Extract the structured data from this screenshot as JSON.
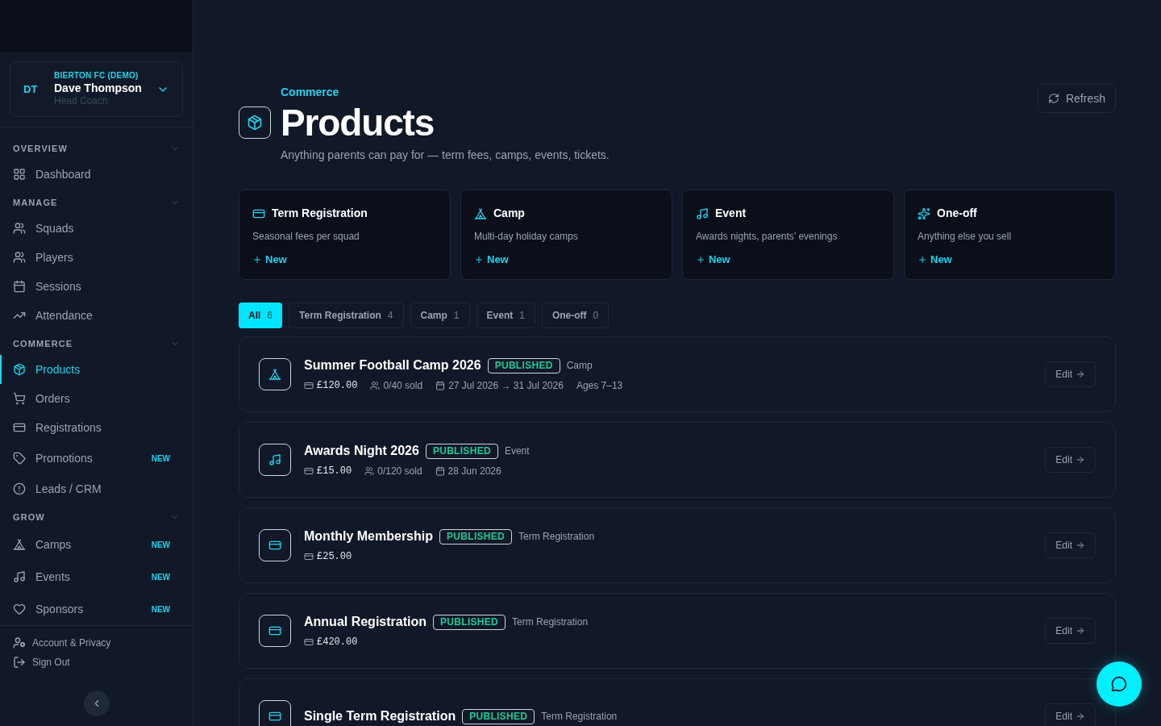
{
  "sidebar": {
    "account": {
      "initials": "DT",
      "org": "BIERTON FC (DEMO)",
      "name": "Dave Thompson",
      "role": "Head Coach"
    },
    "sections": [
      {
        "title": "OVERVIEW",
        "expanded": true,
        "items": [
          {
            "label": "Dashboard",
            "selected": false
          }
        ]
      },
      {
        "title": "MANAGE",
        "expanded": true,
        "items": [
          {
            "label": "Squads",
            "selected": false
          },
          {
            "label": "Players",
            "selected": false
          },
          {
            "label": "Sessions",
            "selected": false
          },
          {
            "label": "Attendance",
            "selected": false
          }
        ]
      },
      {
        "title": "COMMERCE",
        "expanded": true,
        "items": [
          {
            "label": "Products",
            "selected": true
          },
          {
            "label": "Orders",
            "selected": false
          },
          {
            "label": "Registrations",
            "selected": false
          },
          {
            "label": "Promotions",
            "selected": false,
            "badge": "NEW"
          },
          {
            "label": "Leads / CRM",
            "selected": false
          }
        ]
      },
      {
        "title": "GROW",
        "expanded": true,
        "items": [
          {
            "label": "Camps",
            "selected": false,
            "badge": "NEW"
          },
          {
            "label": "Events",
            "selected": false,
            "badge": "NEW"
          },
          {
            "label": "Sponsors",
            "selected": false,
            "badge": "NEW"
          }
        ]
      }
    ],
    "footer_links": [
      "Account & Privacy",
      "Sign Out"
    ]
  },
  "header": {
    "eyebrow": "Commerce",
    "title": "Products",
    "subtitle": "Anything parents can pay for — term fees, camps, events, tickets.",
    "refresh_button": "Refresh"
  },
  "categories": [
    {
      "kind": "term",
      "title": "Term Registration",
      "description": "Seasonal fees per squad",
      "action": "New"
    },
    {
      "kind": "camp",
      "title": "Camp",
      "description": "Multi-day holiday camps",
      "action": "New"
    },
    {
      "kind": "event",
      "title": "Event",
      "description": "Awards nights, parents’ evenings",
      "action": "New"
    },
    {
      "kind": "oneoff",
      "title": "One-off",
      "description": "Anything else you sell",
      "action": "New"
    }
  ],
  "filters": [
    {
      "label": "All",
      "count": "6",
      "selected": true
    },
    {
      "label": "Term Registration",
      "count": "4",
      "selected": false
    },
    {
      "label": "Camp",
      "count": "1",
      "selected": false
    },
    {
      "label": "Event",
      "count": "1",
      "selected": false
    },
    {
      "label": "One-off",
      "count": "0",
      "selected": false
    }
  ],
  "products": [
    {
      "kind": "camp",
      "name": "Summer Football Camp 2026",
      "status": "PUBLISHED",
      "type": "Camp",
      "price": "£120.00",
      "sold": "0/40 sold",
      "dates": "27 Jul 2026 → 31 Jul 2026",
      "ages": "Ages 7–13",
      "action": "Edit"
    },
    {
      "kind": "event",
      "name": "Awards Night 2026",
      "status": "PUBLISHED",
      "type": "Event",
      "price": "£15.00",
      "sold": "0/120 sold",
      "dates": "28 Jun 2026",
      "action": "Edit"
    },
    {
      "kind": "term",
      "name": "Monthly Membership",
      "status": "PUBLISHED",
      "type": "Term Registration",
      "price": "£25.00",
      "action": "Edit"
    },
    {
      "kind": "term",
      "name": "Annual Registration",
      "status": "PUBLISHED",
      "type": "Term Registration",
      "price": "£420.00",
      "action": "Edit"
    },
    {
      "kind": "term",
      "name": "Single Term Registration",
      "status": "PUBLISHED",
      "type": "Term Registration",
      "action": "Edit"
    }
  ]
}
